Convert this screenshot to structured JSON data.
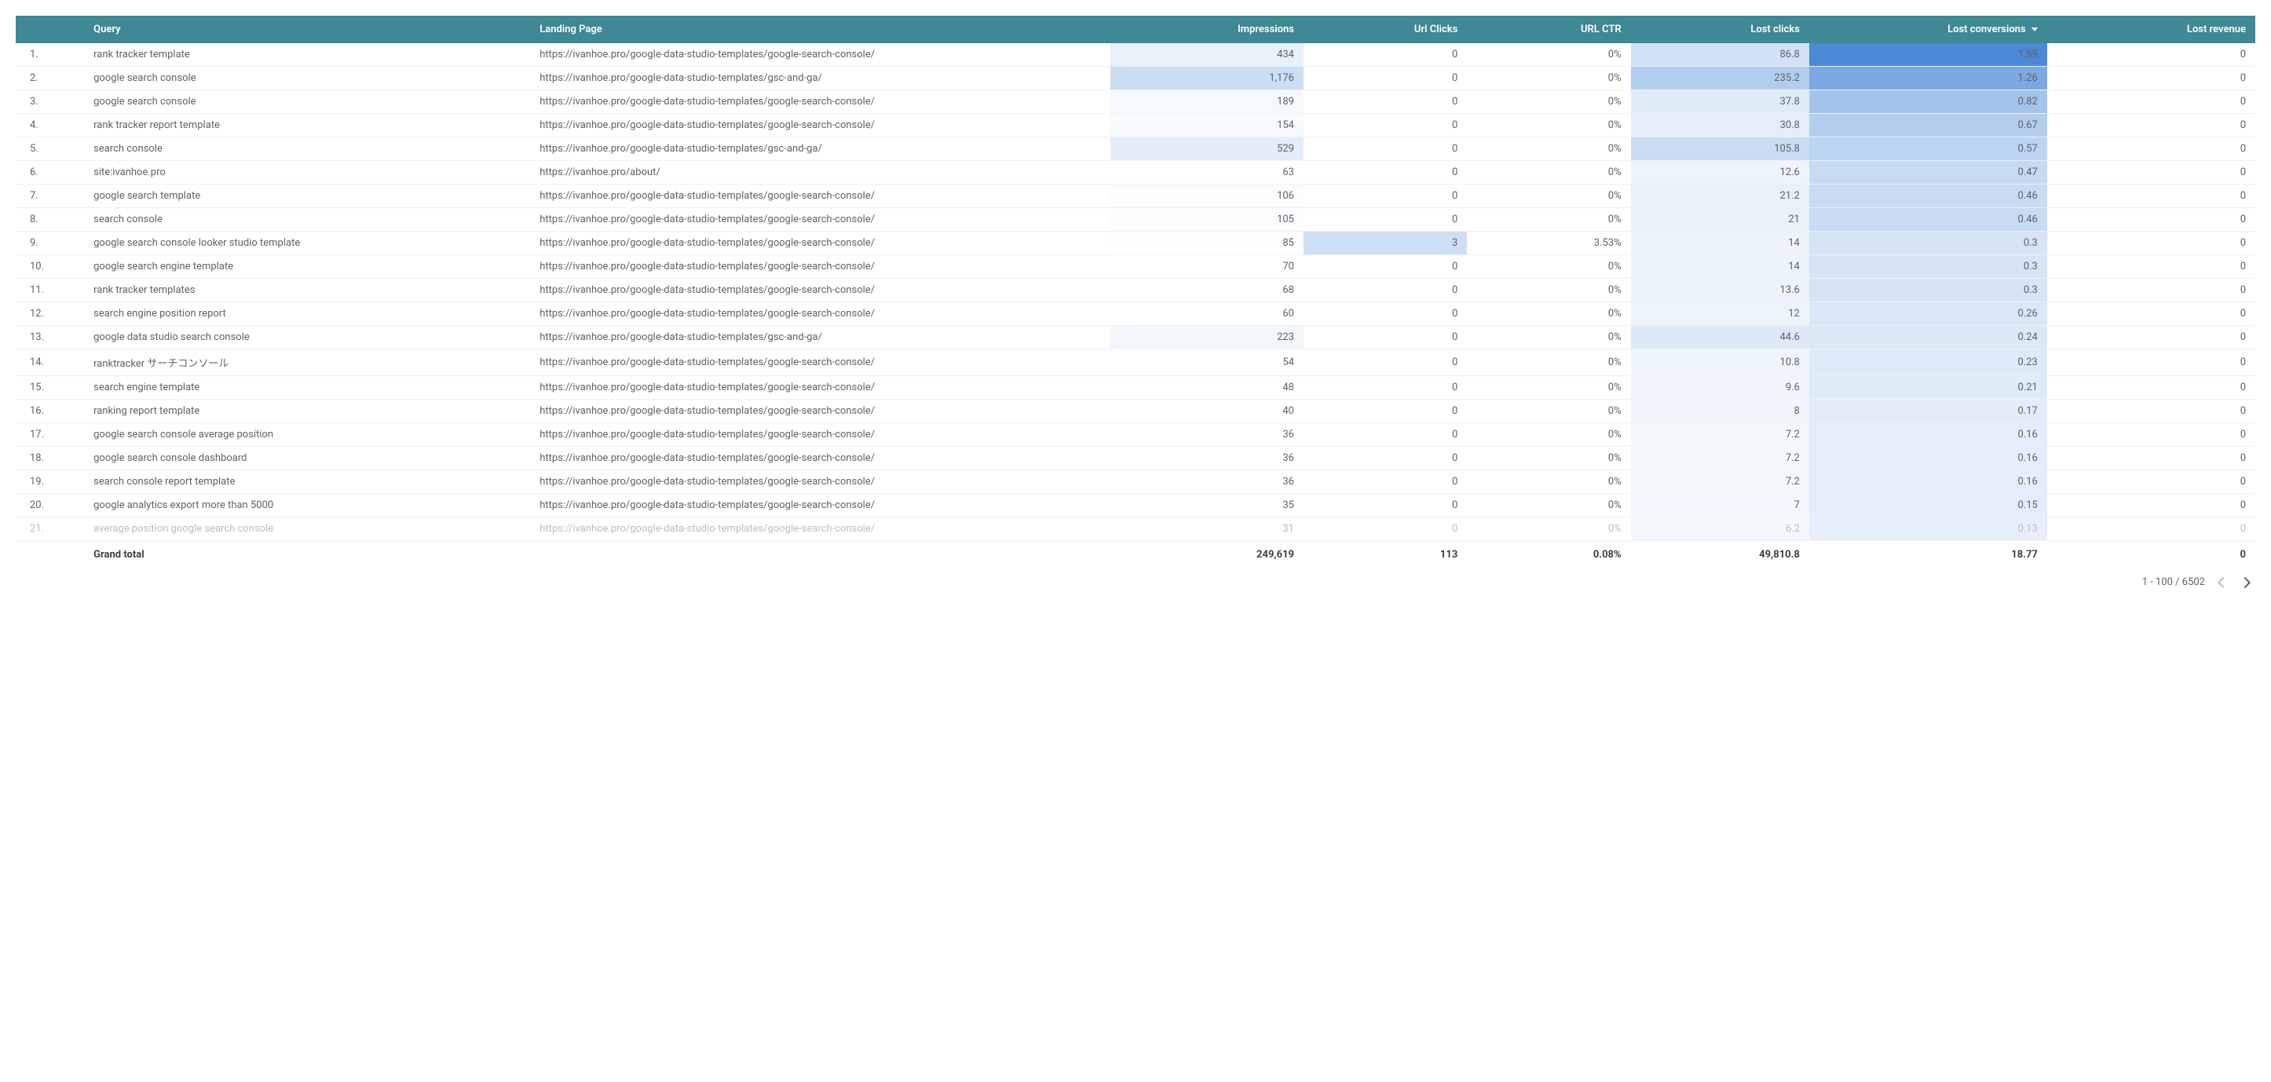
{
  "headers": {
    "query": "Query",
    "landing": "Landing Page",
    "impressions": "Impressions",
    "url_clicks": "Url Clicks",
    "url_ctr": "URL CTR",
    "lost_clicks": "Lost clicks",
    "lost_conversions": "Lost conversions",
    "lost_revenue": "Lost revenue"
  },
  "sort_column": "lost_conversions",
  "sort_direction": "desc",
  "rows": [
    {
      "n": "1.",
      "query": "rank tracker template",
      "landing": "https://ivanhoe.pro/google-data-studio-templates/google-search-console/",
      "impressions": "434",
      "url_clicks": "0",
      "url_ctr": "0%",
      "lost_clicks": "86.8",
      "lost_conversions": "1.89",
      "lost_revenue": "0",
      "imp_shade": "#e8f0fa",
      "clk_shade": "#ffffff",
      "lcl_shade": "#d2e1f5",
      "lcv_shade": "#4b89d6"
    },
    {
      "n": "2.",
      "query": "google search console",
      "landing": "https://ivanhoe.pro/google-data-studio-templates/gsc-and-ga/",
      "impressions": "1,176",
      "url_clicks": "0",
      "url_ctr": "0%",
      "lost_clicks": "235.2",
      "lost_conversions": "1.26",
      "lost_revenue": "0",
      "imp_shade": "#cbdef4",
      "clk_shade": "#ffffff",
      "lcl_shade": "#b3cdef",
      "lcv_shade": "#7ba8e0"
    },
    {
      "n": "3.",
      "query": "google search console",
      "landing": "https://ivanhoe.pro/google-data-studio-templates/google-search-console/",
      "impressions": "189",
      "url_clicks": "0",
      "url_ctr": "0%",
      "lost_clicks": "37.8",
      "lost_conversions": "0.82",
      "lost_revenue": "0",
      "imp_shade": "#f5f9fc",
      "clk_shade": "#ffffff",
      "lcl_shade": "#e0ebf8",
      "lcv_shade": "#a4c3ea"
    },
    {
      "n": "4.",
      "query": "rank tracker report template",
      "landing": "https://ivanhoe.pro/google-data-studio-templates/google-search-console/",
      "impressions": "154",
      "url_clicks": "0",
      "url_ctr": "0%",
      "lost_clicks": "30.8",
      "lost_conversions": "0.67",
      "lost_revenue": "0",
      "imp_shade": "#f7fafd",
      "clk_shade": "#ffffff",
      "lcl_shade": "#e4eef9",
      "lcv_shade": "#b3cdef"
    },
    {
      "n": "5.",
      "query": "search console",
      "landing": "https://ivanhoe.pro/google-data-studio-templates/gsc-and-ga/",
      "impressions": "529",
      "url_clicks": "0",
      "url_ctr": "0%",
      "lost_clicks": "105.8",
      "lost_conversions": "0.57",
      "lost_revenue": "0",
      "imp_shade": "#e2edf9",
      "clk_shade": "#ffffff",
      "lcl_shade": "#c9dcf4",
      "lcv_shade": "#bcd3f1"
    },
    {
      "n": "6.",
      "query": "site:ivanhoe.pro",
      "landing": "https://ivanhoe.pro/about/",
      "impressions": "63",
      "url_clicks": "0",
      "url_ctr": "0%",
      "lost_clicks": "12.6",
      "lost_conversions": "0.47",
      "lost_revenue": "0",
      "imp_shade": "#ffffff",
      "clk_shade": "#ffffff",
      "lcl_shade": "#eef4fb",
      "lcv_shade": "#c6daf3"
    },
    {
      "n": "7.",
      "query": "google search template",
      "landing": "https://ivanhoe.pro/google-data-studio-templates/google-search-console/",
      "impressions": "106",
      "url_clicks": "0",
      "url_ctr": "0%",
      "lost_clicks": "21.2",
      "lost_conversions": "0.46",
      "lost_revenue": "0",
      "imp_shade": "#fbfcfe",
      "clk_shade": "#ffffff",
      "lcl_shade": "#e8f0fa",
      "lcv_shade": "#c8dbf3"
    },
    {
      "n": "8.",
      "query": "search console",
      "landing": "https://ivanhoe.pro/google-data-studio-templates/google-search-console/",
      "impressions": "105",
      "url_clicks": "0",
      "url_ctr": "0%",
      "lost_clicks": "21",
      "lost_conversions": "0.46",
      "lost_revenue": "0",
      "imp_shade": "#fbfcfe",
      "clk_shade": "#ffffff",
      "lcl_shade": "#e8f0fa",
      "lcv_shade": "#c8dbf3"
    },
    {
      "n": "9.",
      "query": "google search console looker studio template",
      "landing": "https://ivanhoe.pro/google-data-studio-templates/google-search-console/",
      "impressions": "85",
      "url_clicks": "3",
      "url_ctr": "3.53%",
      "lost_clicks": "14",
      "lost_conversions": "0.3",
      "lost_revenue": "0",
      "imp_shade": "#fdfefe",
      "clk_shade": "#cedff5",
      "lcl_shade": "#edf3fb",
      "lcv_shade": "#d6e4f6"
    },
    {
      "n": "10.",
      "query": "google search engine template",
      "landing": "https://ivanhoe.pro/google-data-studio-templates/google-search-console/",
      "impressions": "70",
      "url_clicks": "0",
      "url_ctr": "0%",
      "lost_clicks": "14",
      "lost_conversions": "0.3",
      "lost_revenue": "0",
      "imp_shade": "#ffffff",
      "clk_shade": "#ffffff",
      "lcl_shade": "#edf3fb",
      "lcv_shade": "#d6e4f6"
    },
    {
      "n": "11.",
      "query": "rank tracker templates",
      "landing": "https://ivanhoe.pro/google-data-studio-templates/google-search-console/",
      "impressions": "68",
      "url_clicks": "0",
      "url_ctr": "0%",
      "lost_clicks": "13.6",
      "lost_conversions": "0.3",
      "lost_revenue": "0",
      "imp_shade": "#ffffff",
      "clk_shade": "#ffffff",
      "lcl_shade": "#edf3fb",
      "lcv_shade": "#d6e4f6"
    },
    {
      "n": "12.",
      "query": "search engine position report",
      "landing": "https://ivanhoe.pro/google-data-studio-templates/google-search-console/",
      "impressions": "60",
      "url_clicks": "0",
      "url_ctr": "0%",
      "lost_clicks": "12",
      "lost_conversions": "0.26",
      "lost_revenue": "0",
      "imp_shade": "#ffffff",
      "clk_shade": "#ffffff",
      "lcl_shade": "#eef4fb",
      "lcv_shade": "#dae7f7"
    },
    {
      "n": "13.",
      "query": "google data studio search console",
      "landing": "https://ivanhoe.pro/google-data-studio-templates/gsc-and-ga/",
      "impressions": "223",
      "url_clicks": "0",
      "url_ctr": "0%",
      "lost_clicks": "44.6",
      "lost_conversions": "0.24",
      "lost_revenue": "0",
      "imp_shade": "#f3f7fc",
      "clk_shade": "#ffffff",
      "lcl_shade": "#dde9f8",
      "lcv_shade": "#dce9f7"
    },
    {
      "n": "14.",
      "query": "ranktracker サーチコンソール",
      "landing": "https://ivanhoe.pro/google-data-studio-templates/google-search-console/",
      "impressions": "54",
      "url_clicks": "0",
      "url_ctr": "0%",
      "lost_clicks": "10.8",
      "lost_conversions": "0.23",
      "lost_revenue": "0",
      "imp_shade": "#ffffff",
      "clk_shade": "#ffffff",
      "lcl_shade": "#eff5fc",
      "lcv_shade": "#ddeaf8"
    },
    {
      "n": "15.",
      "query": "search engine template",
      "landing": "https://ivanhoe.pro/google-data-studio-templates/google-search-console/",
      "impressions": "48",
      "url_clicks": "0",
      "url_ctr": "0%",
      "lost_clicks": "9.6",
      "lost_conversions": "0.21",
      "lost_revenue": "0",
      "imp_shade": "#ffffff",
      "clk_shade": "#ffffff",
      "lcl_shade": "#f0f5fc",
      "lcv_shade": "#deebf8"
    },
    {
      "n": "16.",
      "query": "ranking report template",
      "landing": "https://ivanhoe.pro/google-data-studio-templates/google-search-console/",
      "impressions": "40",
      "url_clicks": "0",
      "url_ctr": "0%",
      "lost_clicks": "8",
      "lost_conversions": "0.17",
      "lost_revenue": "0",
      "imp_shade": "#ffffff",
      "clk_shade": "#ffffff",
      "lcl_shade": "#f2f6fc",
      "lcv_shade": "#e2edf9"
    },
    {
      "n": "17.",
      "query": "google search console average position",
      "landing": "https://ivanhoe.pro/google-data-studio-templates/google-search-console/",
      "impressions": "36",
      "url_clicks": "0",
      "url_ctr": "0%",
      "lost_clicks": "7.2",
      "lost_conversions": "0.16",
      "lost_revenue": "0",
      "imp_shade": "#ffffff",
      "clk_shade": "#ffffff",
      "lcl_shade": "#f2f7fc",
      "lcv_shade": "#e3eef9"
    },
    {
      "n": "18.",
      "query": "google search console dashboard",
      "landing": "https://ivanhoe.pro/google-data-studio-templates/google-search-console/",
      "impressions": "36",
      "url_clicks": "0",
      "url_ctr": "0%",
      "lost_clicks": "7.2",
      "lost_conversions": "0.16",
      "lost_revenue": "0",
      "imp_shade": "#ffffff",
      "clk_shade": "#ffffff",
      "lcl_shade": "#f2f7fc",
      "lcv_shade": "#e3eef9"
    },
    {
      "n": "19.",
      "query": "search console report template",
      "landing": "https://ivanhoe.pro/google-data-studio-templates/google-search-console/",
      "impressions": "36",
      "url_clicks": "0",
      "url_ctr": "0%",
      "lost_clicks": "7.2",
      "lost_conversions": "0.16",
      "lost_revenue": "0",
      "imp_shade": "#ffffff",
      "clk_shade": "#ffffff",
      "lcl_shade": "#f2f7fc",
      "lcv_shade": "#e3eef9"
    },
    {
      "n": "20.",
      "query": "google analytics export more than 5000",
      "landing": "https://ivanhoe.pro/google-data-studio-templates/google-search-console/",
      "impressions": "35",
      "url_clicks": "0",
      "url_ctr": "0%",
      "lost_clicks": "7",
      "lost_conversions": "0.15",
      "lost_revenue": "0",
      "imp_shade": "#ffffff",
      "clk_shade": "#ffffff",
      "lcl_shade": "#f3f7fd",
      "lcv_shade": "#e4eef9"
    },
    {
      "n": "21.",
      "query": "average position google search console",
      "landing": "https://ivanhoe.pro/google-data-studio-templates/google-search-console/",
      "impressions": "31",
      "url_clicks": "0",
      "url_ctr": "0%",
      "lost_clicks": "6.2",
      "lost_conversions": "0.13",
      "lost_revenue": "0",
      "imp_shade": "#ffffff",
      "clk_shade": "#ffffff",
      "lcl_shade": "#f4f8fd",
      "lcv_shade": "#e6effa",
      "cutoff": true
    }
  ],
  "totals": {
    "label": "Grand total",
    "impressions": "249,619",
    "url_clicks": "113",
    "url_ctr": "0.08%",
    "lost_clicks": "49,810.8",
    "lost_conversions": "18.77",
    "lost_revenue": "0"
  },
  "pagination": {
    "range": "1 - 100 / 6502"
  }
}
